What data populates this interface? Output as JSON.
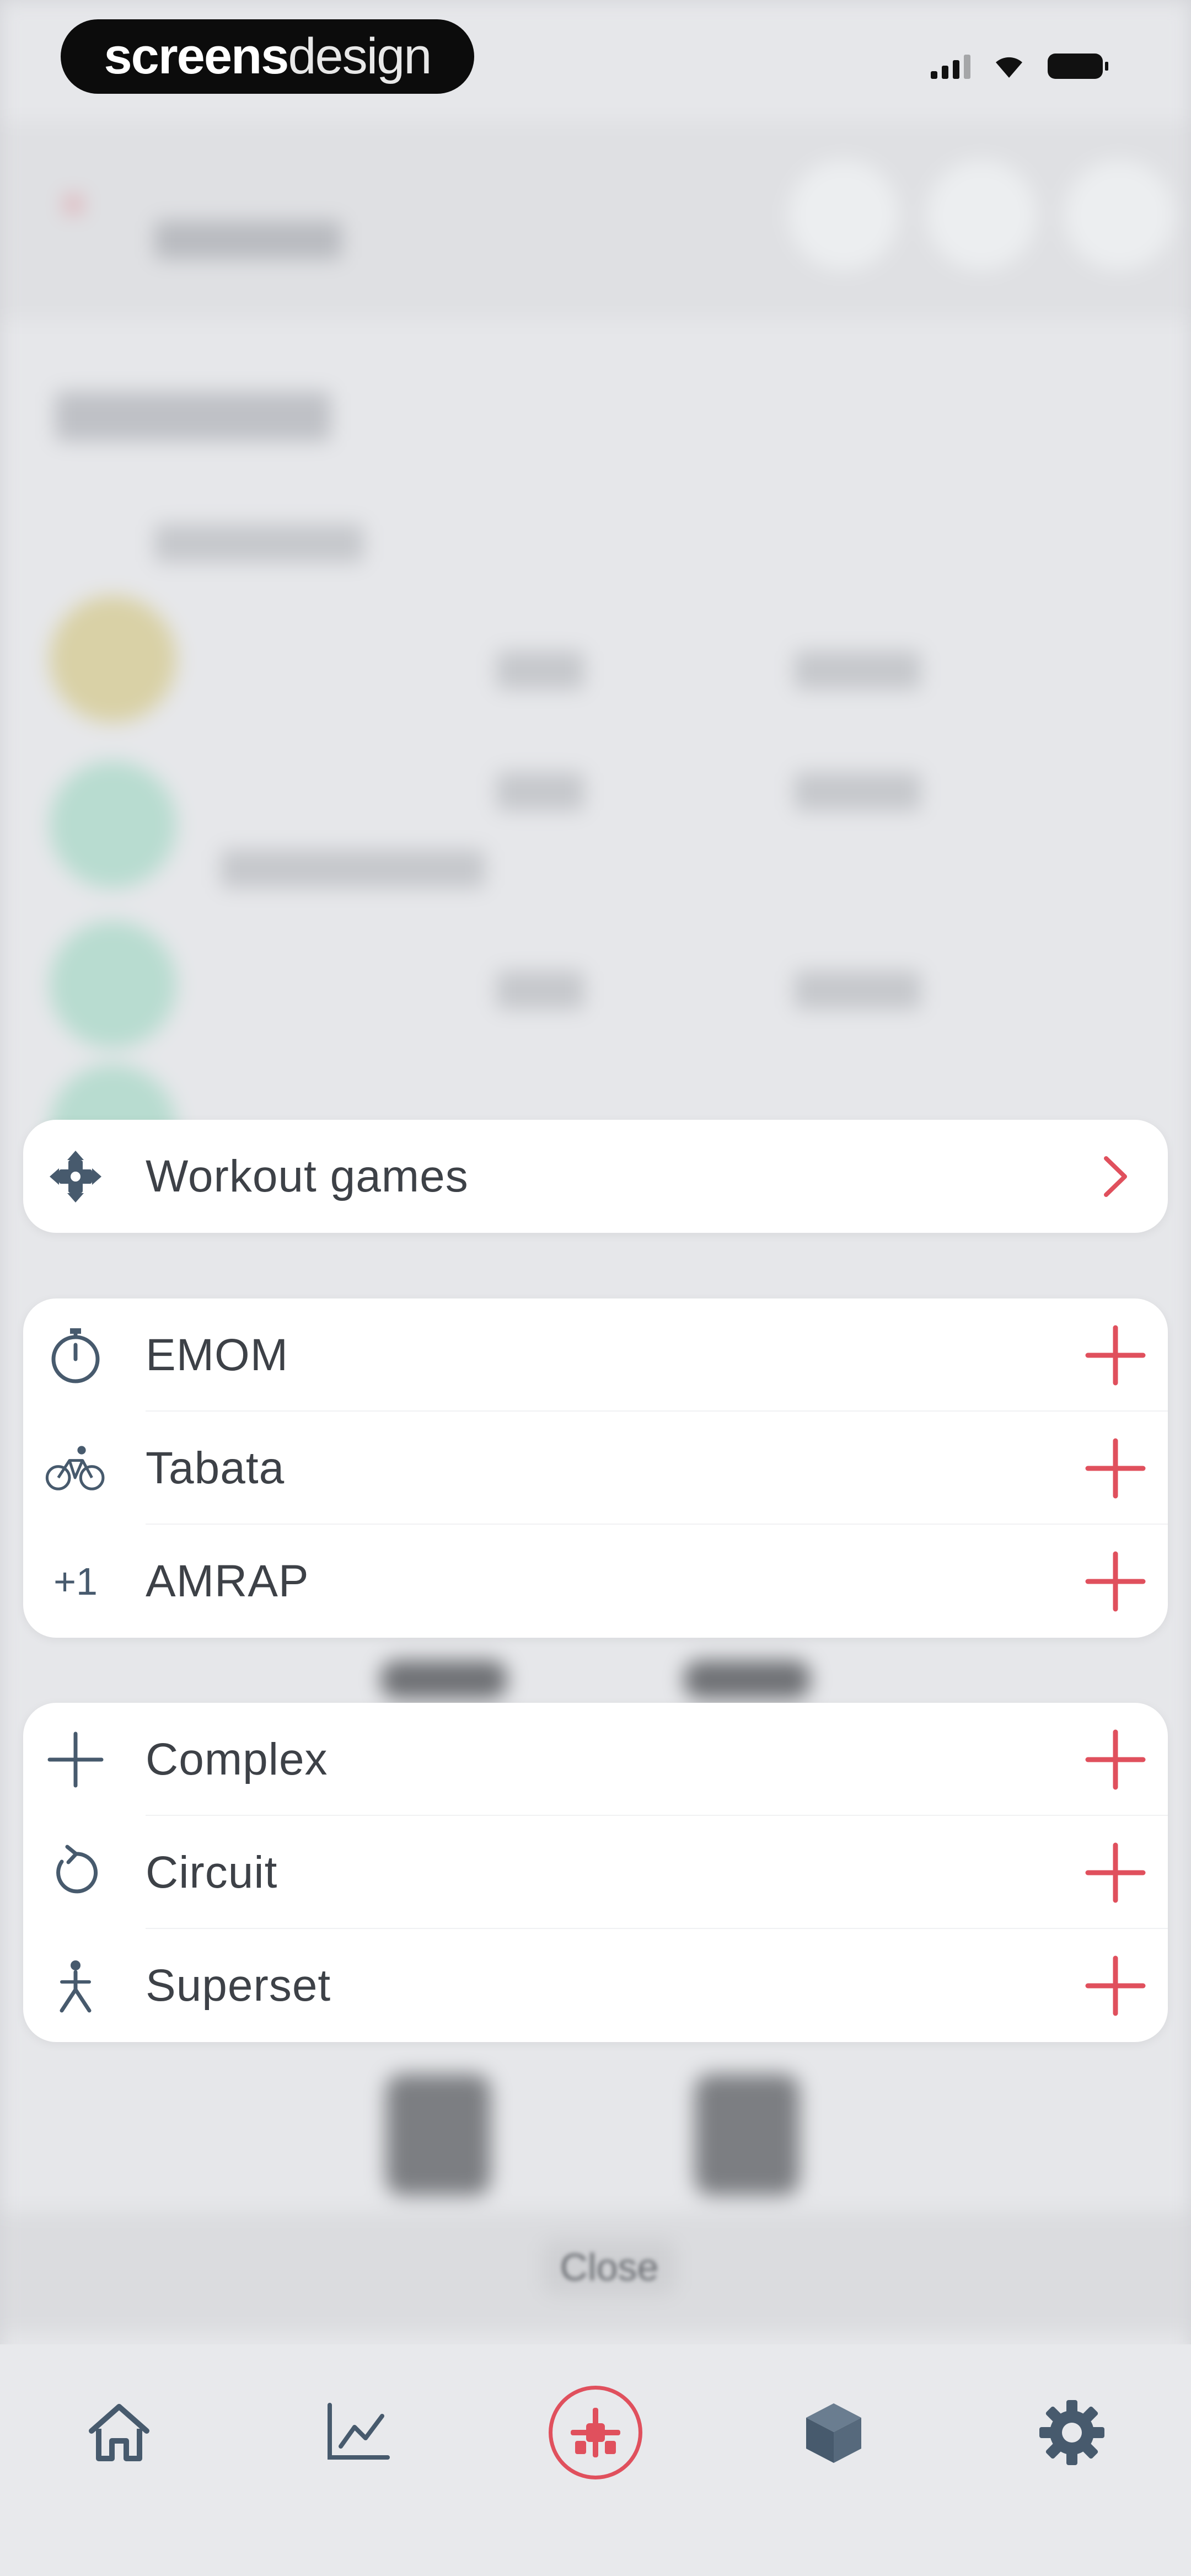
{
  "status_bar": {
    "brand_bold": "screens",
    "brand_light": "design"
  },
  "menu": {
    "games_card": [
      {
        "label": "Workout games",
        "icon": "gamepad-icon",
        "action": "chevron-right-icon"
      }
    ],
    "timed_card": [
      {
        "label": "EMOM",
        "icon": "stopwatch-icon",
        "action": "plus-icon"
      },
      {
        "label": "Tabata",
        "icon": "bicycle-icon",
        "action": "plus-icon"
      },
      {
        "label": "AMRAP",
        "icon": "plus-one-icon",
        "icon_text": "+1",
        "action": "plus-icon"
      }
    ],
    "set_card": [
      {
        "label": "Complex",
        "icon": "cross-icon",
        "action": "plus-icon"
      },
      {
        "label": "Circuit",
        "icon": "circular-arrow-icon",
        "action": "plus-icon"
      },
      {
        "label": "Superset",
        "icon": "person-split-icon",
        "action": "plus-icon"
      }
    ]
  },
  "close_label": "Close",
  "tab_bar": {
    "tabs": [
      {
        "icon": "home-icon",
        "active": false
      },
      {
        "icon": "chart-icon",
        "active": false
      },
      {
        "icon": "workout-icon",
        "active": true
      },
      {
        "icon": "cube-icon",
        "active": false
      },
      {
        "icon": "gear-icon",
        "active": false
      }
    ]
  },
  "colors": {
    "accent": "#e0505d",
    "icon": "#475a6d",
    "text": "#3d4147",
    "card": "#ffffff",
    "tab_bar_bg": "#e8e9ec"
  }
}
